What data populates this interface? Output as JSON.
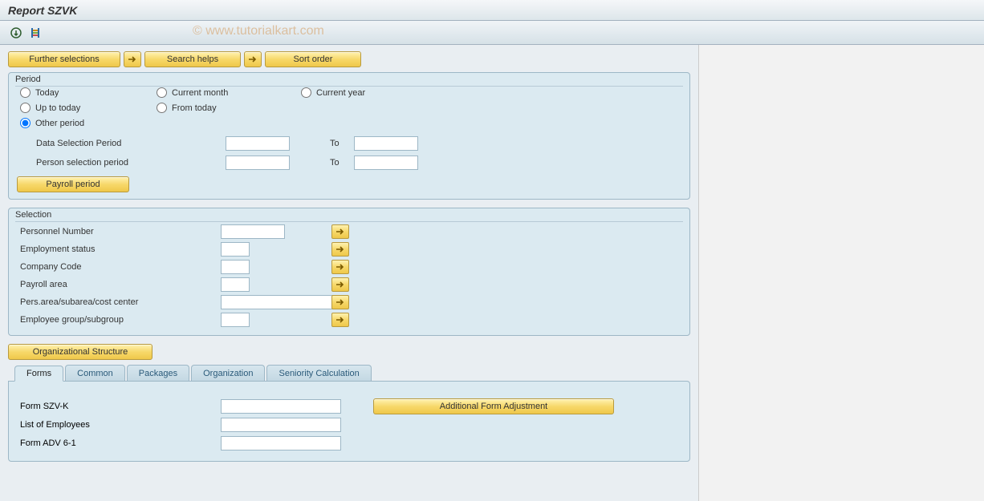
{
  "title": "Report SZVK",
  "watermark": "© www.tutorialkart.com",
  "toolbar": {
    "further_selections": "Further selections",
    "search_helps": "Search helps",
    "sort_order": "Sort order"
  },
  "period": {
    "legend": "Period",
    "radios": {
      "today": "Today",
      "current_month": "Current month",
      "current_year": "Current year",
      "up_to_today": "Up to today",
      "from_today": "From today",
      "other_period": "Other period"
    },
    "selected": "other_period",
    "data_selection_label": "Data Selection Period",
    "person_selection_label": "Person selection period",
    "to_label": "To",
    "payroll_period_btn": "Payroll period",
    "values": {
      "data_from": "",
      "data_to": "",
      "person_from": "",
      "person_to": ""
    }
  },
  "selection": {
    "legend": "Selection",
    "rows": [
      {
        "label": "Personnel Number",
        "input_w": "w-80",
        "value": ""
      },
      {
        "label": "Employment status",
        "input_w": "w-40",
        "value": ""
      },
      {
        "label": "Company Code",
        "input_w": "w-40",
        "value": ""
      },
      {
        "label": "Payroll area",
        "input_w": "w-40",
        "value": ""
      },
      {
        "label": "Pers.area/subarea/cost center",
        "input_w": "w-150",
        "value": ""
      },
      {
        "label": "Employee group/subgroup",
        "input_w": "w-40",
        "value": ""
      }
    ]
  },
  "org_structure_btn": "Organizational Structure",
  "tabs": [
    {
      "label": "Forms",
      "active": true
    },
    {
      "label": "Common",
      "active": false
    },
    {
      "label": "Packages",
      "active": false
    },
    {
      "label": "Organization",
      "active": false
    },
    {
      "label": "Seniority Calculation",
      "active": false
    }
  ],
  "forms_tab": {
    "rows": [
      {
        "label": "Form SZV-K",
        "value": ""
      },
      {
        "label": "List of Employees",
        "value": ""
      },
      {
        "label": "Form ADV 6-1",
        "value": ""
      }
    ],
    "additional_btn": "Additional Form Adjustment"
  }
}
